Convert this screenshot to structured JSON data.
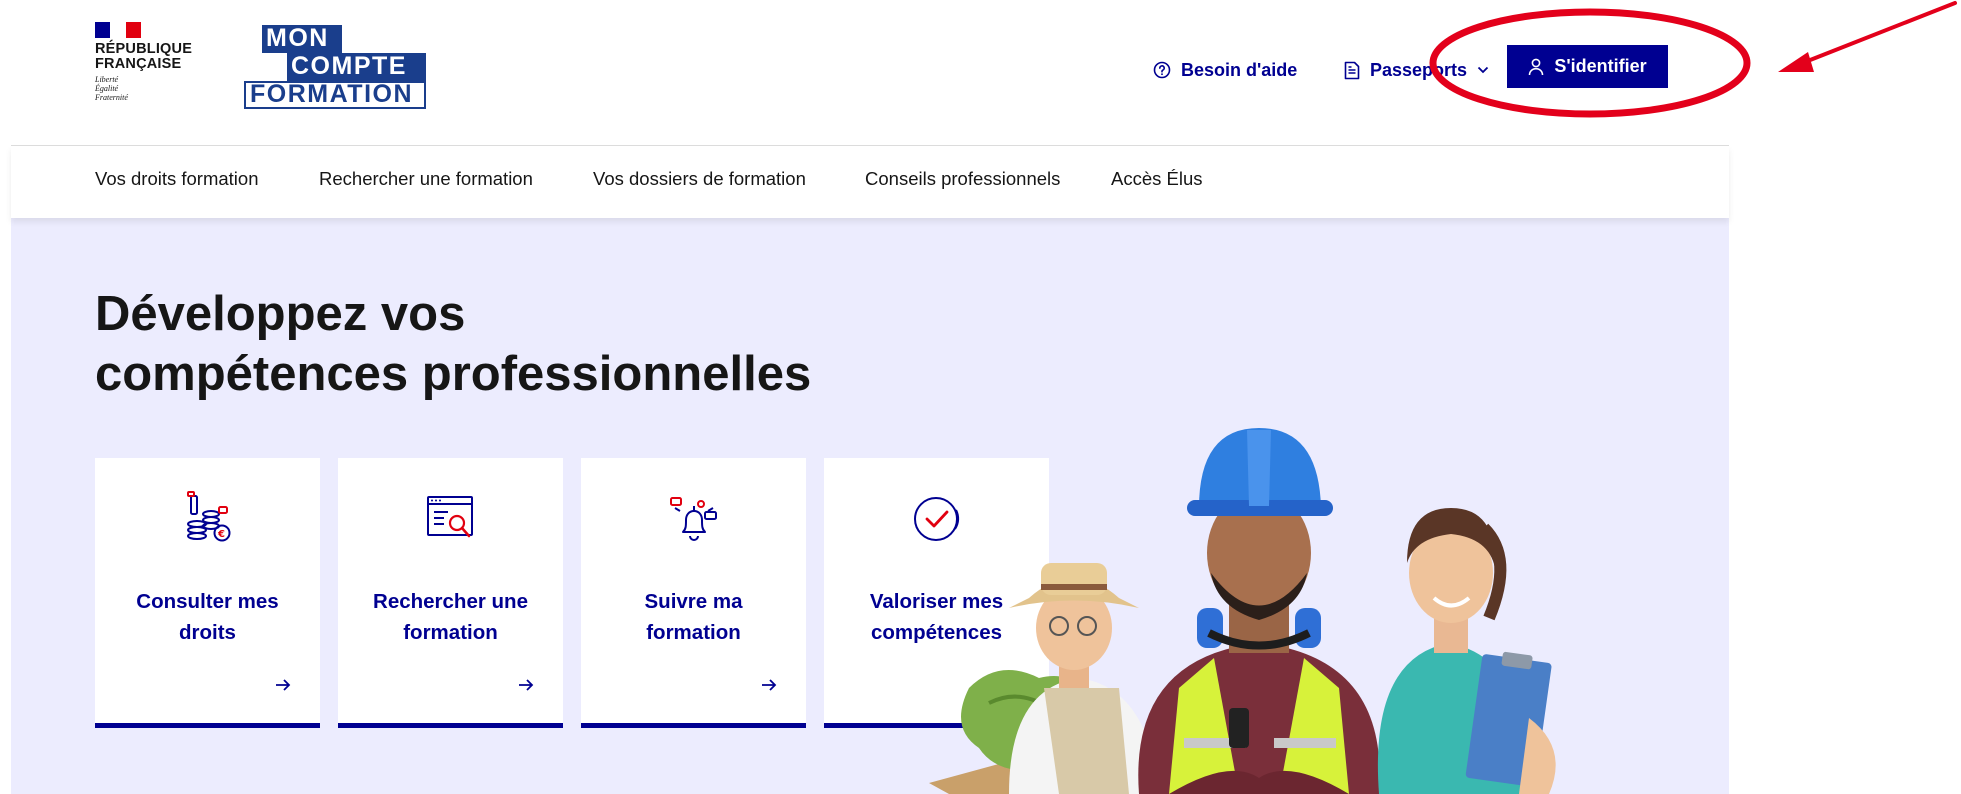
{
  "header": {
    "republic": {
      "line1": "RÉPUBLIQUE",
      "line2": "FRANÇAISE",
      "motto1": "Liberté",
      "motto2": "Égalité",
      "motto3": "Fraternité"
    },
    "brand": {
      "line1": "MON",
      "line2": "COMPTE",
      "line3": "FORMATION"
    },
    "tools": {
      "help_label": "Besoin d'aide",
      "passports_label": "Passeports",
      "login_label": "S'identifier"
    }
  },
  "nav": {
    "items": [
      "Vos droits formation",
      "Rechercher une formation",
      "Vos dossiers de formation",
      "Conseils professionnels",
      "Accès Élus"
    ]
  },
  "hero": {
    "title_line1": "Développez vos",
    "title_line2": "compétences professionnelles",
    "tiles": [
      {
        "line1": "Consulter mes",
        "line2": "droits",
        "icon": "coins-euro-icon",
        "action": "arrow-right-icon"
      },
      {
        "line1": "Rechercher une",
        "line2": "formation",
        "icon": "search-document-icon",
        "action": "arrow-right-icon"
      },
      {
        "line1": "Suivre ma",
        "line2": "formation",
        "icon": "notification-bell-icon",
        "action": "arrow-right-icon"
      },
      {
        "line1": "Valoriser mes",
        "line2": "compétences",
        "icon": "check-circle-icon",
        "action": "external-link-icon"
      }
    ]
  },
  "colors": {
    "primary": "#000091",
    "brand_blue": "#1a3e8c",
    "hero_bg": "#ececfe",
    "accent_red": "#e1000f",
    "annotation_red": "#e3001b"
  }
}
